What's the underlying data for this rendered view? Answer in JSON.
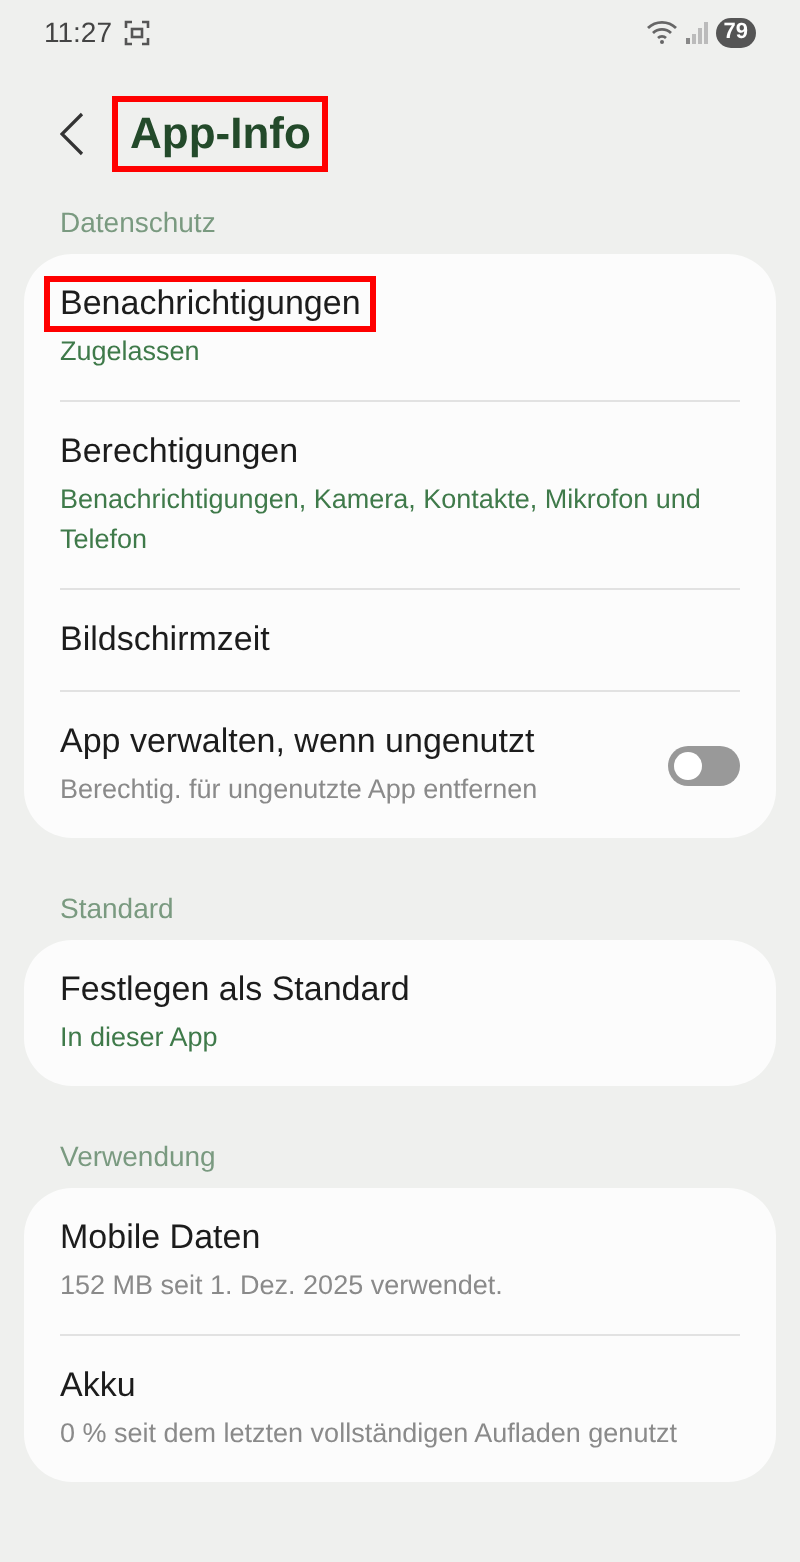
{
  "status_bar": {
    "time": "11:27",
    "battery": "79"
  },
  "header": {
    "title": "App-Info",
    "highlighted": true
  },
  "sections": [
    {
      "label": "Datenschutz",
      "items": [
        {
          "kind": "text",
          "title": "Benachrichtigungen",
          "subtitle": "Zugelassen",
          "color": "#3f7a4a",
          "highlighted": true
        },
        {
          "kind": "text",
          "title": "Berechtigungen",
          "subtitle": "Benachrichtigungen, Kamera, Kontakte, Mikrofon und Telefon",
          "color": "#3f7a4a",
          "highlighted": false
        },
        {
          "kind": "text",
          "title": "Bildschirmzeit",
          "highlighted": false
        },
        {
          "kind": "toggle",
          "title": "App verwalten, wenn ungenutzt",
          "subtitle": "Berechtig. für ungenutzte App entfernen",
          "color": "#8a8a8a",
          "highlighted": false,
          "on": false
        }
      ]
    },
    {
      "label": "Standard",
      "items": [
        {
          "kind": "text",
          "title": "Festlegen als Standard",
          "subtitle": "In dieser App",
          "color": "#3f7a4a",
          "highlighted": false
        }
      ]
    },
    {
      "label": "Verwendung",
      "items": [
        {
          "kind": "text",
          "title": "Mobile Daten",
          "subtitle": "152 MB seit 1. Dez. 2025 verwendet.",
          "color": "#8a8a8a",
          "highlighted": false
        },
        {
          "kind": "text",
          "title": "Akku",
          "subtitle": "0 % seit dem letzten vollständigen Aufladen genutzt",
          "color": "#8a8a8a",
          "highlighted": false
        }
      ]
    }
  ]
}
